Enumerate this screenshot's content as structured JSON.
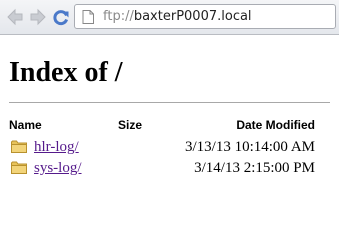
{
  "toolbar": {
    "back_icon": "back-arrow-icon",
    "forward_icon": "forward-arrow-icon",
    "reload_icon": "reload-icon",
    "url_scheme": "ftp://",
    "url_host": "baxterP0007.local"
  },
  "page": {
    "title": "Index of /",
    "columns": {
      "name": "Name",
      "size": "Size",
      "date": "Date Modified"
    },
    "entries": [
      {
        "name": "hlr-log/",
        "size": "",
        "date": "3/13/13 10:14:00 AM",
        "icon": "folder-icon"
      },
      {
        "name": "sys-log/",
        "size": "",
        "date": "3/14/13 2:15:00 PM",
        "icon": "folder-icon"
      }
    ]
  },
  "colors": {
    "link_visited": "#551a8b",
    "folder": "#e8c35a"
  }
}
